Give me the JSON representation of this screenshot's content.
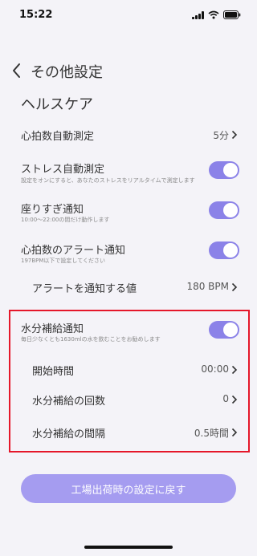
{
  "status": {
    "time": "15:22"
  },
  "header": {
    "title": "その他設定"
  },
  "section_title": "ヘルスケア",
  "rows": {
    "hr_auto": {
      "label": "心拍数自動測定",
      "value": "5分"
    },
    "stress": {
      "label": "ストレス自動測定",
      "sub": "設定をオンにすると、あなたのストレスをリアルタイムで測定します",
      "toggle_on": true
    },
    "sedentary": {
      "label": "座りすぎ通知",
      "sub": "10:00〜22:00の間だけ動作します",
      "toggle_on": true
    },
    "hr_alert": {
      "label": "心拍数のアラート通知",
      "sub": "197BPM以下で設定してください",
      "toggle_on": true
    },
    "alert_value": {
      "label": "アラートを通知する値",
      "value": "180 BPM"
    },
    "hydration": {
      "label": "水分補給通知",
      "sub": "毎日少なくとも1630mlの水を飲むことをお勧めします",
      "toggle_on": true
    },
    "start_time": {
      "label": "開始時間",
      "value": "00:00"
    },
    "count": {
      "label": "水分補給の回数",
      "value": "0"
    },
    "interval": {
      "label": "水分補給の間隔",
      "value": "0.5時間"
    }
  },
  "reset_button": {
    "label": "工場出荷時の設定に戻す"
  },
  "colors": {
    "accent": "#8b82e8",
    "button": "#a59cf0",
    "highlight": "#e5172a",
    "background": "#f4f3f8"
  }
}
